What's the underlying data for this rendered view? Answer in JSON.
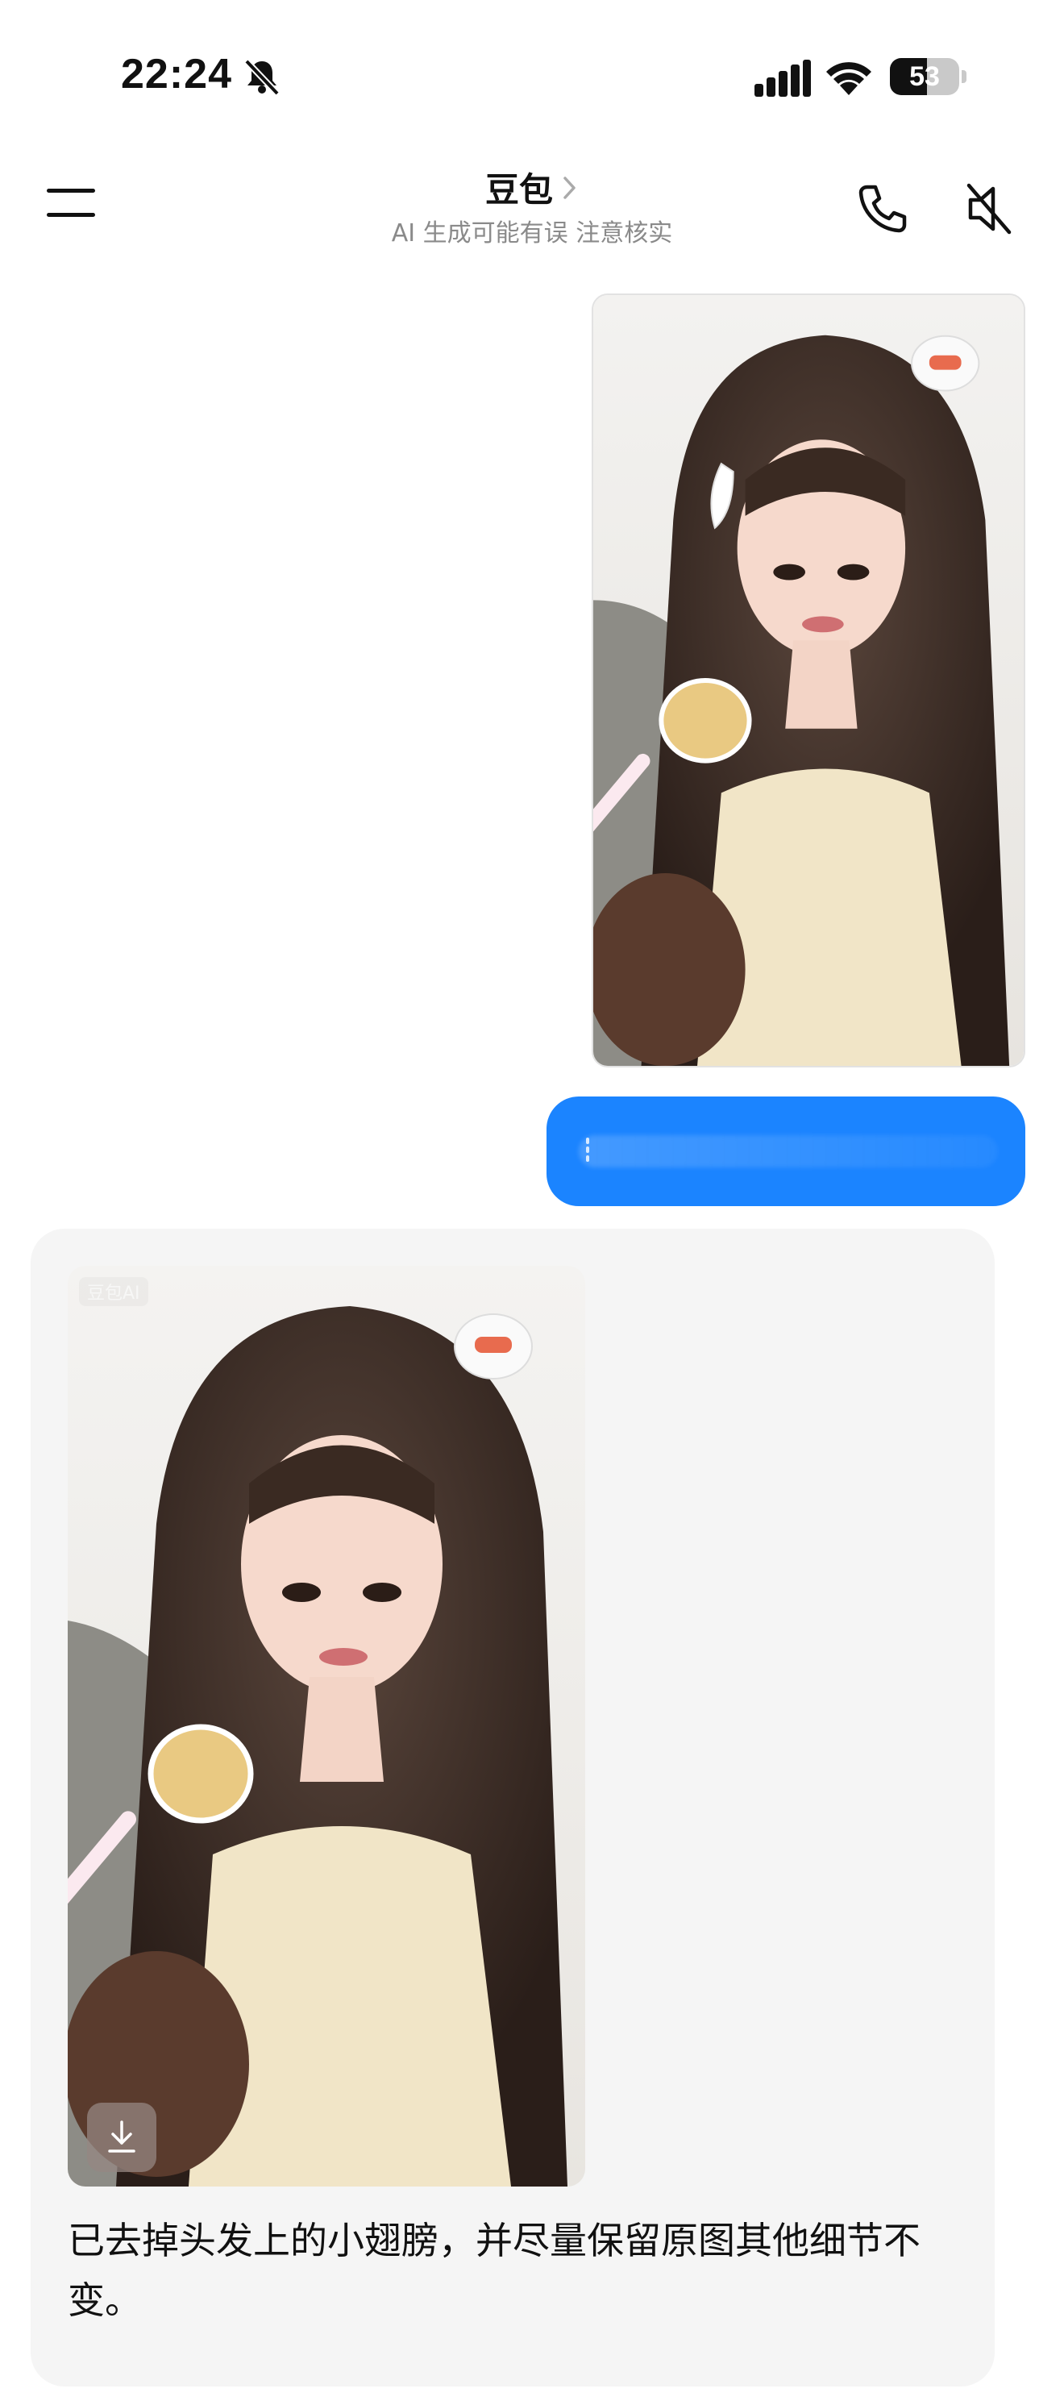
{
  "status_bar": {
    "time": "22:24",
    "battery_level": 53,
    "icons": [
      "bell-off-icon",
      "signal-icon",
      "wifi-icon",
      "battery-icon"
    ]
  },
  "header": {
    "title": "豆包",
    "subtitle": "AI 生成可能有误 注意核实",
    "icons": [
      "menu-icon",
      "chevron-right-icon",
      "phone-icon",
      "speaker-off-icon"
    ]
  },
  "conversation": {
    "user_message": {
      "image_alt": "Selfie of a girl with long hair holding a spoon",
      "text_redacted": true
    },
    "ai_message": {
      "watermark": "豆包AI",
      "download_icon": "download-icon",
      "text": "已去掉头发上的小翅膀，并尽量保留原图其他细节不变。"
    }
  },
  "colors": {
    "user_bubble": "#1b84ff",
    "ai_card": "#f5f5f5",
    "subtitle": "#8a8a8a"
  }
}
